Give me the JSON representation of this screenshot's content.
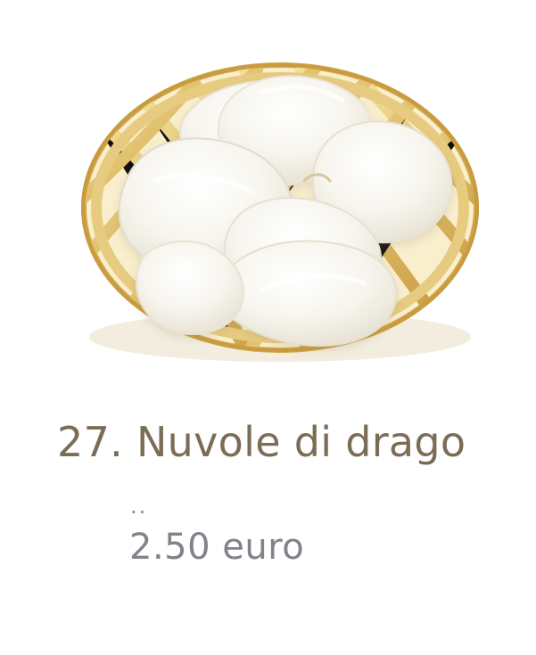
{
  "product": {
    "title": "27. Nuvole di drago",
    "description": "..",
    "price": "2.50 euro",
    "image_icon": "shrimp-crackers-basket-image"
  },
  "colors": {
    "background": "#ffffff",
    "title": "#7b6d55",
    "price": "#808389",
    "basket": "#e3c47b",
    "basket_dark": "#c69c45",
    "crackers": "#f5f2e8"
  }
}
